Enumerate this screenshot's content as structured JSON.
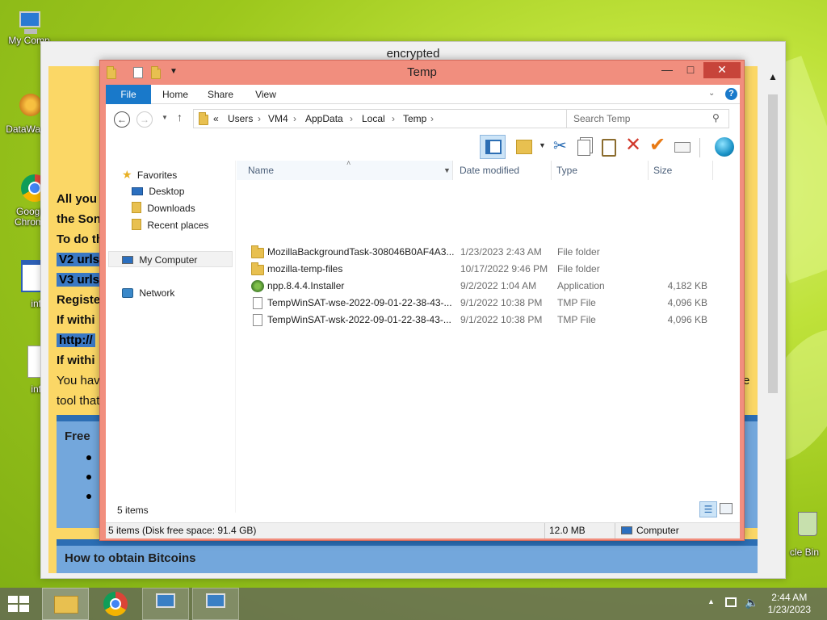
{
  "desktop": {
    "icons": [
      {
        "label": "My Comp"
      },
      {
        "label": "DataWag"
      },
      {
        "label": "Googl Chrom"
      },
      {
        "label": "info"
      },
      {
        "label": "info"
      },
      {
        "label": "cle Bin"
      }
    ]
  },
  "encrypted_window": {
    "title": "encrypted",
    "lines": [
      "All you",
      "the Son",
      "To do th",
      "V2 urls",
      "V3 urls",
      "Registe",
      "If withi",
      "http://",
      "If withi",
      "You hav",
      "tool that"
    ],
    "right_fragment": "e",
    "box1_title": "Free",
    "box2_title": "How to obtain Bitcoins"
  },
  "explorer": {
    "title": "Temp",
    "ribbon_tabs": [
      "File",
      "Home",
      "Share",
      "View"
    ],
    "address_path": [
      "«",
      "Users",
      "VM4",
      "AppData",
      "Local",
      "Temp"
    ],
    "search_placeholder": "Search Temp",
    "nav": {
      "favorites": "Favorites",
      "desktop": "Desktop",
      "downloads": "Downloads",
      "recent": "Recent places",
      "computer": "My Computer",
      "network": "Network"
    },
    "columns": [
      "Name",
      "Date modified",
      "Type",
      "Size"
    ],
    "files": [
      {
        "name": "MozillaBackgroundTask-308046B0AF4A3...",
        "date": "1/23/2023 2:43 AM",
        "type": "File folder",
        "size": "",
        "icon": "folder-icon"
      },
      {
        "name": "mozilla-temp-files",
        "date": "10/17/2022 9:46 PM",
        "type": "File folder",
        "size": "",
        "icon": "folder-icon"
      },
      {
        "name": "npp.8.4.4.Installer",
        "date": "9/2/2022 1:04 AM",
        "type": "Application",
        "size": "4,182 KB",
        "icon": "installer-icon"
      },
      {
        "name": "TempWinSAT-wse-2022-09-01-22-38-43-...",
        "date": "9/1/2022 10:38 PM",
        "type": "TMP File",
        "size": "4,096 KB",
        "icon": "file-icon"
      },
      {
        "name": "TempWinSAT-wsk-2022-09-01-22-38-43-...",
        "date": "9/1/2022 10:38 PM",
        "type": "TMP File",
        "size": "4,096 KB",
        "icon": "file-icon"
      }
    ],
    "item_count": "5 items",
    "status": {
      "left": "5 items (Disk free space: 91.4 GB)",
      "size": "12.0 MB",
      "location": "Computer"
    }
  },
  "taskbar": {
    "time": "2:44 AM",
    "date": "1/23/2023"
  },
  "colors": {
    "explorer_frame": "#f18e7e",
    "file_tab": "#1979ca",
    "close_button": "#c7443a",
    "encrypted_bg": "#fbd766",
    "encrypted_box": "#73a7dc"
  }
}
